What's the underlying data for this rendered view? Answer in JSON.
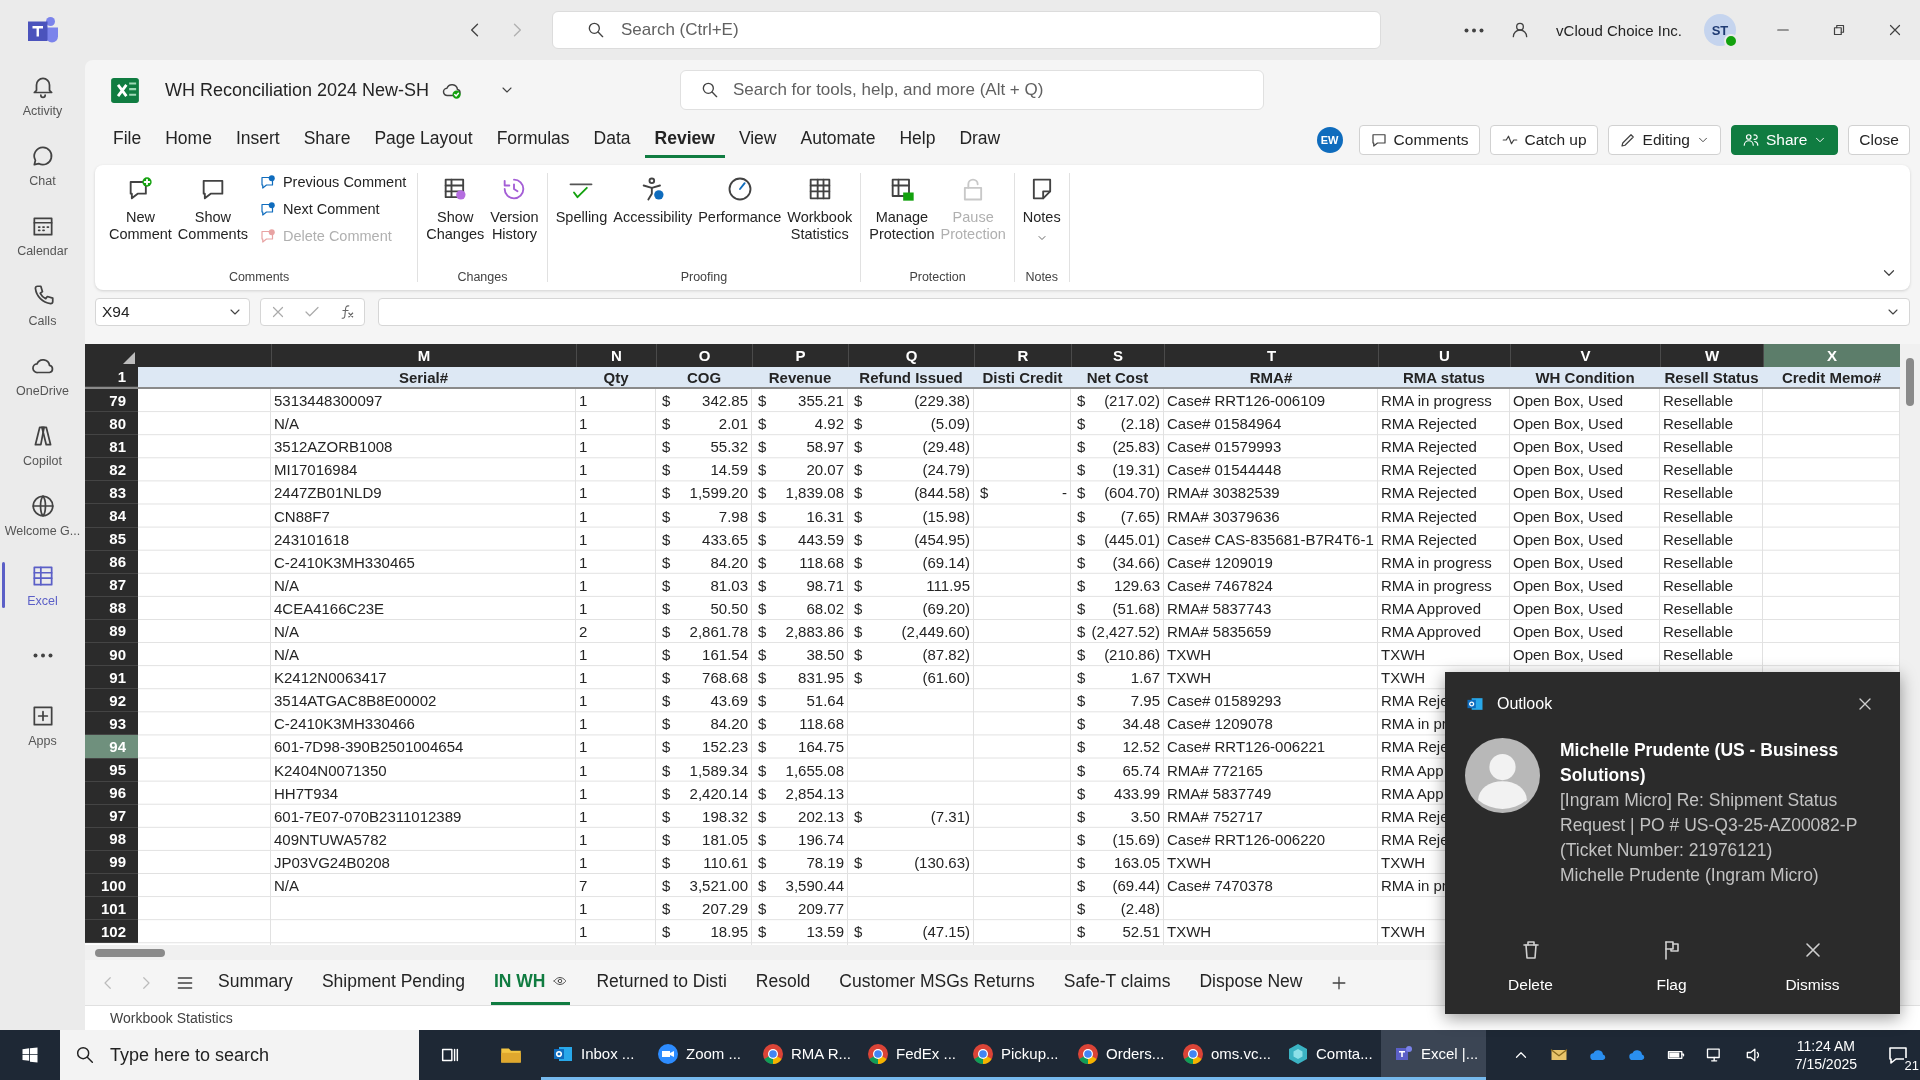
{
  "teams": {
    "search": {
      "placeholder": "Search (Ctrl+E)"
    },
    "org": "vCloud Choice Inc.",
    "avatar": "ST"
  },
  "rail": [
    {
      "kind": "app",
      "label": "Activity",
      "selected": false
    },
    {
      "kind": "app",
      "label": "Chat",
      "selected": false
    },
    {
      "kind": "app",
      "label": "Calendar",
      "selected": false
    },
    {
      "kind": "app",
      "label": "Calls",
      "selected": false
    },
    {
      "kind": "app",
      "label": "OneDrive",
      "selected": false
    },
    {
      "kind": "app",
      "label": "Copilot",
      "selected": false
    },
    {
      "kind": "app",
      "label": "Welcome G...",
      "selected": false
    },
    {
      "kind": "app",
      "label": "Excel",
      "selected": true
    },
    {
      "kind": "more",
      "selected": false
    },
    {
      "kind": "app",
      "label": "Apps",
      "selected": false
    }
  ],
  "excel": {
    "title": "WH Reconciliation 2024 New-SH",
    "search": {
      "placeholder": "Search for tools, help, and more (Alt + Q)"
    },
    "menu": [
      {
        "label": "File",
        "selected": false
      },
      {
        "label": "Home",
        "selected": false
      },
      {
        "label": "Insert",
        "selected": false
      },
      {
        "label": "Share",
        "selected": false
      },
      {
        "label": "Page Layout",
        "selected": false
      },
      {
        "label": "Formulas",
        "selected": false
      },
      {
        "label": "Data",
        "selected": false
      },
      {
        "label": "Review",
        "selected": true
      },
      {
        "label": "View",
        "selected": false
      },
      {
        "label": "Automate",
        "selected": false
      },
      {
        "label": "Help",
        "selected": false
      },
      {
        "label": "Draw",
        "selected": false
      }
    ],
    "user_badge": "EW",
    "actions": [
      {
        "label": "Comments",
        "kind": "comments"
      },
      {
        "label": "Catch up",
        "kind": "catch_up"
      },
      {
        "label": "Editing",
        "kind": "mode"
      },
      {
        "label": "Share",
        "kind": "share"
      },
      {
        "label": "Close",
        "kind": "close"
      }
    ],
    "ribbon": [
      {
        "label": "Comments",
        "buttons": [
          {
            "label": "New Comment",
            "kind": "large",
            "disabled": false
          },
          {
            "label": "Show Comments",
            "kind": "large",
            "disabled": false
          },
          {
            "label": "Previous Comment",
            "kind": "small",
            "disabled": false
          },
          {
            "label": "Next Comment",
            "kind": "small",
            "disabled": false
          },
          {
            "label": "Delete Comment",
            "kind": "small",
            "disabled": true
          }
        ]
      },
      {
        "label": "Changes",
        "buttons": [
          {
            "label": "Show Changes",
            "kind": "large",
            "disabled": false
          },
          {
            "label": "Version History",
            "kind": "large",
            "disabled": false
          }
        ]
      },
      {
        "label": "Proofing",
        "buttons": [
          {
            "label": "Spelling",
            "kind": "large",
            "disabled": false
          },
          {
            "label": "Accessibility",
            "kind": "large",
            "disabled": false
          },
          {
            "label": "Performance",
            "kind": "large",
            "disabled": false
          },
          {
            "label": "Workbook Statistics",
            "kind": "large",
            "disabled": false
          }
        ]
      },
      {
        "label": "Protection",
        "buttons": [
          {
            "label": "Manage Protection",
            "kind": "large",
            "disabled": false
          },
          {
            "label": "Pause Protection",
            "kind": "large",
            "disabled": true
          }
        ]
      },
      {
        "label": "Notes",
        "buttons": [
          {
            "label": "Notes",
            "kind": "dropdown",
            "disabled": false
          }
        ]
      }
    ],
    "name_box": "X94",
    "header_row": "1",
    "columns": [
      {
        "letter": "M",
        "title": "Serial#",
        "kind": "text",
        "selected": false
      },
      {
        "letter": "N",
        "title": "Qty",
        "kind": "text",
        "selected": false
      },
      {
        "letter": "O",
        "title": "COG",
        "kind": "money",
        "selected": false
      },
      {
        "letter": "P",
        "title": "Revenue",
        "kind": "money",
        "selected": false
      },
      {
        "letter": "Q",
        "title": "Refund Issued",
        "kind": "money",
        "selected": false
      },
      {
        "letter": "R",
        "title": "Disti Credit",
        "kind": "money",
        "selected": false
      },
      {
        "letter": "S",
        "title": "Net Cost",
        "kind": "money",
        "selected": false
      },
      {
        "letter": "T",
        "title": "RMA#",
        "kind": "text",
        "selected": false
      },
      {
        "letter": "U",
        "title": "RMA status",
        "kind": "text",
        "selected": false
      },
      {
        "letter": "V",
        "title": "WH Condition",
        "kind": "text",
        "selected": false
      },
      {
        "letter": "W",
        "title": "Resell Status",
        "kind": "text",
        "selected": false
      },
      {
        "letter": "X",
        "title": "Credit Memo#",
        "kind": "text",
        "selected": true
      }
    ],
    "rows": [
      {
        "number": "79",
        "selected": false,
        "cells": [
          "5313448300097",
          "1",
          [
            "$",
            "342.85"
          ],
          [
            "$",
            "355.21"
          ],
          [
            "$",
            "(229.38)"
          ],
          null,
          [
            "$",
            "(217.02)"
          ],
          "Case# RRT126-006109",
          "RMA in progress",
          "Open Box, Used",
          "Resellable"
        ]
      },
      {
        "number": "80",
        "selected": false,
        "cells": [
          "N/A",
          "1",
          [
            "$",
            "2.01"
          ],
          [
            "$",
            "4.92"
          ],
          [
            "$",
            "(5.09)"
          ],
          null,
          [
            "$",
            "(2.18)"
          ],
          "Case# 01584964",
          "RMA Rejected",
          "Open Box, Used",
          "Resellable"
        ]
      },
      {
        "number": "81",
        "selected": false,
        "cells": [
          "3512AZORB1008",
          "1",
          [
            "$",
            "55.32"
          ],
          [
            "$",
            "58.97"
          ],
          [
            "$",
            "(29.48)"
          ],
          null,
          [
            "$",
            "(25.83)"
          ],
          "Case# 01579993",
          "RMA Rejected",
          "Open Box, Used",
          "Resellable"
        ]
      },
      {
        "number": "82",
        "selected": false,
        "cells": [
          "MI17016984",
          "1",
          [
            "$",
            "14.59"
          ],
          [
            "$",
            "20.07"
          ],
          [
            "$",
            "(24.79)"
          ],
          null,
          [
            "$",
            "(19.31)"
          ],
          "Case# 01544448",
          "RMA Rejected",
          "Open Box, Used",
          "Resellable"
        ]
      },
      {
        "number": "83",
        "selected": false,
        "cells": [
          "2447ZB01NLD9",
          "1",
          [
            "$",
            "1,599.20"
          ],
          [
            "$",
            "1,839.08"
          ],
          [
            "$",
            "(844.58)"
          ],
          [
            "$",
            "-"
          ],
          [
            "$",
            "(604.70)"
          ],
          "RMA# 30382539",
          "RMA Rejected",
          "Open Box, Used",
          "Resellable"
        ]
      },
      {
        "number": "84",
        "selected": false,
        "cells": [
          "CN88F7",
          "1",
          [
            "$",
            "7.98"
          ],
          [
            "$",
            "16.31"
          ],
          [
            "$",
            "(15.98)"
          ],
          null,
          [
            "$",
            "(7.65)"
          ],
          "RMA# 30379636",
          "RMA Rejected",
          "Open Box, Used",
          "Resellable"
        ]
      },
      {
        "number": "85",
        "selected": false,
        "cells": [
          "243101618",
          "1",
          [
            "$",
            "433.65"
          ],
          [
            "$",
            "443.59"
          ],
          [
            "$",
            "(454.95)"
          ],
          null,
          [
            "$",
            "(445.01)"
          ],
          "Case# CAS-835681-B7R4T6-1",
          "RMA Rejected",
          "Open Box, Used",
          "Resellable"
        ]
      },
      {
        "number": "86",
        "selected": false,
        "cells": [
          "C-2410K3MH330465",
          "1",
          [
            "$",
            "84.20"
          ],
          [
            "$",
            "118.68"
          ],
          [
            "$",
            "(69.14)"
          ],
          null,
          [
            "$",
            "(34.66)"
          ],
          "Case# 1209019",
          "RMA in progress",
          "Open Box, Used",
          "Resellable"
        ]
      },
      {
        "number": "87",
        "selected": false,
        "cells": [
          "N/A",
          "1",
          [
            "$",
            "81.03"
          ],
          [
            "$",
            "98.71"
          ],
          [
            "$",
            "111.95"
          ],
          null,
          [
            "$",
            "129.63"
          ],
          "Case# 7467824",
          "RMA in progress",
          "Open Box, Used",
          "Resellable"
        ]
      },
      {
        "number": "88",
        "selected": false,
        "cells": [
          "4CEA4166C23E",
          "1",
          [
            "$",
            "50.50"
          ],
          [
            "$",
            "68.02"
          ],
          [
            "$",
            "(69.20)"
          ],
          null,
          [
            "$",
            "(51.68)"
          ],
          "RMA# 5837743",
          "RMA Approved",
          "Open Box, Used",
          "Resellable"
        ]
      },
      {
        "number": "89",
        "selected": false,
        "cells": [
          "N/A",
          "2",
          [
            "$",
            "2,861.78"
          ],
          [
            "$",
            "2,883.86"
          ],
          [
            "$",
            "(2,449.60)"
          ],
          null,
          [
            "$",
            "(2,427.52)"
          ],
          "RMA# 5835659",
          "RMA Approved",
          "Open Box, Used",
          "Resellable"
        ]
      },
      {
        "number": "90",
        "selected": false,
        "cells": [
          "N/A",
          "1",
          [
            "$",
            "161.54"
          ],
          [
            "$",
            "38.50"
          ],
          [
            "$",
            "(87.82)"
          ],
          null,
          [
            "$",
            "(210.86)"
          ],
          "TXWH",
          "TXWH",
          "Open Box, Used",
          "Resellable"
        ]
      },
      {
        "number": "91",
        "selected": false,
        "cells": [
          "K2412N0063417",
          "1",
          [
            "$",
            "768.68"
          ],
          [
            "$",
            "831.95"
          ],
          [
            "$",
            "(61.60)"
          ],
          null,
          [
            "$",
            "1.67"
          ],
          "TXWH",
          "TXWH"
        ]
      },
      {
        "number": "92",
        "selected": false,
        "cells": [
          "3514ATGAC8B8E00002",
          "1",
          [
            "$",
            "43.69"
          ],
          [
            "$",
            "51.64"
          ],
          null,
          null,
          [
            "$",
            "7.95"
          ],
          "Case# 01589293",
          "RMA Reje"
        ]
      },
      {
        "number": "93",
        "selected": false,
        "cells": [
          "C-2410K3MH330466",
          "1",
          [
            "$",
            "84.20"
          ],
          [
            "$",
            "118.68"
          ],
          null,
          null,
          [
            "$",
            "34.48"
          ],
          "Case# 1209078",
          "RMA in pr"
        ]
      },
      {
        "number": "94",
        "selected": true,
        "cells": [
          "601-7D98-390B2501004654",
          "1",
          [
            "$",
            "152.23"
          ],
          [
            "$",
            "164.75"
          ],
          null,
          null,
          [
            "$",
            "12.52"
          ],
          "Case# RRT126-006221",
          "RMA Reje"
        ]
      },
      {
        "number": "95",
        "selected": false,
        "cells": [
          "K2404N0071350",
          "1",
          [
            "$",
            "1,589.34"
          ],
          [
            "$",
            "1,655.08"
          ],
          null,
          null,
          [
            "$",
            "65.74"
          ],
          "RMA# 772165",
          "RMA App"
        ]
      },
      {
        "number": "96",
        "selected": false,
        "cells": [
          "HH7T934",
          "1",
          [
            "$",
            "2,420.14"
          ],
          [
            "$",
            "2,854.13"
          ],
          null,
          null,
          [
            "$",
            "433.99"
          ],
          "RMA# 5837749",
          "RMA App"
        ]
      },
      {
        "number": "97",
        "selected": false,
        "cells": [
          "601-7E07-070B2311012389",
          "1",
          [
            "$",
            "198.32"
          ],
          [
            "$",
            "202.13"
          ],
          [
            "$",
            "(7.31)"
          ],
          null,
          [
            "$",
            "3.50"
          ],
          "RMA# 752717",
          "RMA Reje"
        ]
      },
      {
        "number": "98",
        "selected": false,
        "cells": [
          "409NTUWA5782",
          "1",
          [
            "$",
            "181.05"
          ],
          [
            "$",
            "196.74"
          ],
          null,
          null,
          [
            "$",
            "(15.69)"
          ],
          "Case# RRT126-006220",
          "RMA Reje"
        ]
      },
      {
        "number": "99",
        "selected": false,
        "cells": [
          "JP03VG24B0208",
          "1",
          [
            "$",
            "110.61"
          ],
          [
            "$",
            "78.19"
          ],
          [
            "$",
            "(130.63)"
          ],
          null,
          [
            "$",
            "163.05"
          ],
          "TXWH",
          "TXWH"
        ]
      },
      {
        "number": "100",
        "selected": false,
        "cells": [
          "N/A",
          "7",
          [
            "$",
            "3,521.00"
          ],
          [
            "$",
            "3,590.44"
          ],
          null,
          null,
          [
            "$",
            "(69.44)"
          ],
          "Case# 7470378",
          "RMA in pr"
        ]
      },
      {
        "number": "101",
        "selected": false,
        "cells": [
          null,
          "1",
          [
            "$",
            "207.29"
          ],
          [
            "$",
            "209.77"
          ],
          null,
          null,
          [
            "$",
            "(2.48)"
          ]
        ]
      },
      {
        "number": "102",
        "selected": false,
        "cells": [
          null,
          "1",
          [
            "$",
            "18.95"
          ],
          [
            "$",
            "13.59"
          ],
          [
            "$",
            "(47.15)"
          ],
          null,
          [
            "$",
            "52.51"
          ],
          "TXWH",
          "TXWH"
        ]
      }
    ],
    "sheets": [
      {
        "label": "Summary",
        "selected": false
      },
      {
        "label": "Shipment Pending",
        "selected": false
      },
      {
        "label": "IN WH",
        "selected": true
      },
      {
        "label": "Returned to Disti",
        "selected": false
      },
      {
        "label": "Resold",
        "selected": false
      },
      {
        "label": "Customer MSGs Returns",
        "selected": false
      },
      {
        "label": "Safe-T claims",
        "selected": false
      },
      {
        "label": "Dispose New",
        "selected": false
      }
    ],
    "status_bar": "Workbook Statistics"
  },
  "notification": {
    "app": "Outlook",
    "sender": "Michelle Prudente (US - Business Solutions)",
    "subject": "[Ingram Micro] Re: Shipment Status Request | PO # US-Q3-25-AZ00082-P (Ticket Number: 21976121)",
    "preview": "Michelle Prudente (Ingram Micro)",
    "actions": [
      "Delete",
      "Flag",
      "Dismiss"
    ]
  },
  "taskbar": {
    "search": {
      "placeholder": "Type here to search"
    },
    "apps": [
      {
        "label": "Inbox ...",
        "selected": false
      },
      {
        "label": "Zoom ...",
        "selected": false
      },
      {
        "label": "RMA R...",
        "selected": false
      },
      {
        "label": "FedEx ...",
        "selected": false
      },
      {
        "label": "Pickup...",
        "selected": false
      },
      {
        "label": "Orders...",
        "selected": false
      },
      {
        "label": "oms.vc...",
        "selected": false
      },
      {
        "label": "Comta...",
        "selected": false
      },
      {
        "label": "Excel |...",
        "selected": true
      }
    ],
    "time": "11:24 AM",
    "date": "7/15/2025",
    "notifications": "21"
  }
}
